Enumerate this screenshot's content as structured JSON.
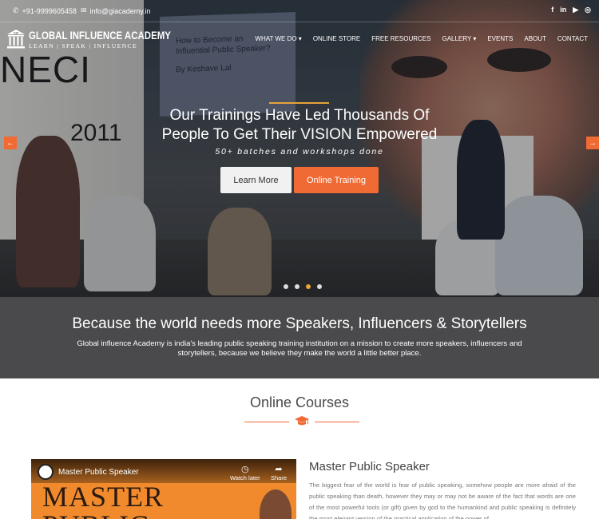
{
  "topbar": {
    "phone": "+91-9999605458",
    "email": "info@giacademy.in",
    "socials": [
      "f",
      "in",
      "yt",
      "ig"
    ]
  },
  "logo": {
    "name": "GLOBAL INFLUENCE ACADEMY",
    "tagline": "LEARN | SPEAK | INFLUENCE",
    "mark": "GIA"
  },
  "nav": {
    "items": [
      {
        "label": "WHAT WE DO",
        "dropdown": true
      },
      {
        "label": "ONLINE STORE",
        "dropdown": false
      },
      {
        "label": "FREE RESOURCES",
        "dropdown": false
      },
      {
        "label": "GALLERY",
        "dropdown": true
      },
      {
        "label": "EVENTS",
        "dropdown": false
      },
      {
        "label": "ABOUT",
        "dropdown": false
      },
      {
        "label": "CONTACT",
        "dropdown": false
      }
    ]
  },
  "hero": {
    "title_line1": "Our Trainings Have Led Thousands Of",
    "title_line2": "People To Get Their VISION Empowered",
    "subtitle": "50+ batches and workshops done",
    "learn_more": "Learn More",
    "online_training": "Online Training",
    "slide_count": 4,
    "active_slide": 3,
    "backdrop_projector_title": "How to Become an Influential Public Speaker?",
    "backdrop_projector_author": "By Keshave Lal",
    "backdrop_wall_text": "NECI",
    "backdrop_wall_num": "2011"
  },
  "band": {
    "heading": "Because the world needs more Speakers, Influencers & Storytellers",
    "text": "Global influence Academy is india's leading public speaking training institution on a mission to create more speakers, influencers and storytellers, because we believe they make the world a little better place."
  },
  "courses": {
    "title": "Online Courses",
    "video": {
      "title": "Master Public Speaker",
      "watch_later": "Watch later",
      "share": "Share",
      "thumb_line1": "MASTER",
      "thumb_line2": "PUBLIC"
    },
    "course_title": "Master Public Speaker",
    "course_text": "The biggest fear of the world is fear of public speaking, somehow people are more afraid of the public speaking than death, however they may or may not be aware of the fact that words are one of the most powerful tools (or gift) given by god to the humankind and public speaking is definitely the most elegant version of the practical application of the power of"
  },
  "colors": {
    "accent": "#f06a34",
    "gold": "#e8a43a",
    "band": "#4a4a4c"
  }
}
